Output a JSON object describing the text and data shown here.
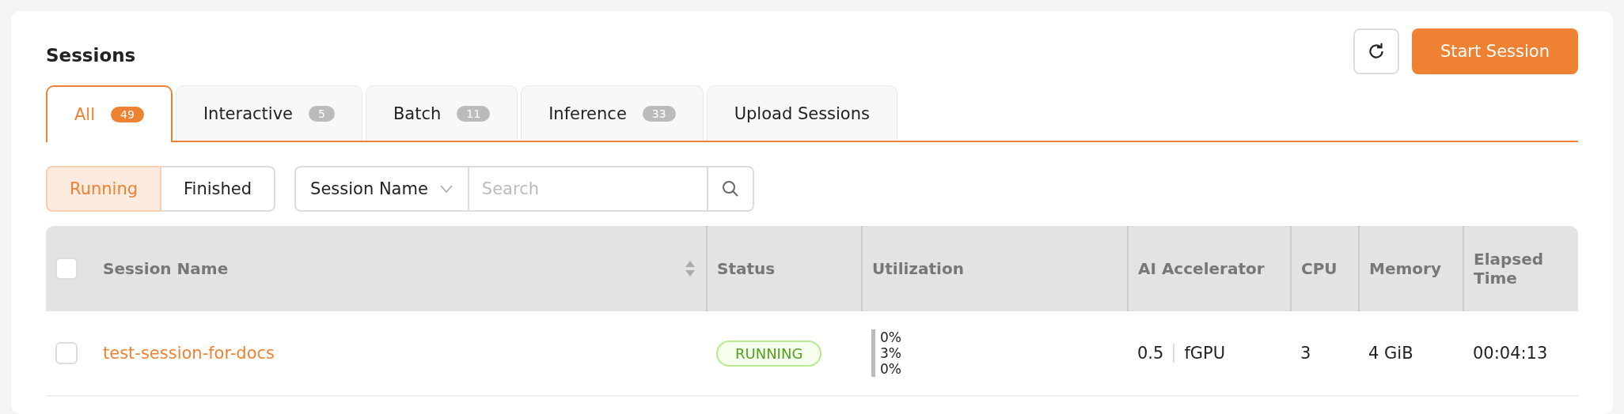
{
  "title": "Sessions",
  "toolbar": {
    "primary_button": "Start Session"
  },
  "tabs": [
    {
      "label": "All",
      "count": "49",
      "selected": true
    },
    {
      "label": "Interactive",
      "count": "5",
      "selected": false
    },
    {
      "label": "Batch",
      "count": "11",
      "selected": false
    },
    {
      "label": "Inference",
      "count": "33",
      "selected": false
    },
    {
      "label": "Upload Sessions",
      "selected": false
    }
  ],
  "filter": [
    {
      "label": "Running",
      "selected": true
    },
    {
      "label": "Finished",
      "selected": false
    }
  ],
  "search": {
    "field": "Session Name",
    "placeholder": "Search"
  },
  "table": {
    "all_checked": false,
    "columns": [
      "Session Name",
      "Status",
      "Utilization",
      "AI Accelerator",
      "CPU",
      "Memory",
      "Elapsed Time"
    ],
    "rows": [
      {
        "checked": false,
        "name": "test-session-for-docs",
        "status": "RUNNING",
        "utilization": [
          "0%",
          "3%",
          "0%"
        ],
        "accelerator_amount": "0.5",
        "accelerator_type": "fGPU",
        "cpu": "3",
        "memory": "4 GiB",
        "elapsed": "00:04:13"
      }
    ]
  }
}
